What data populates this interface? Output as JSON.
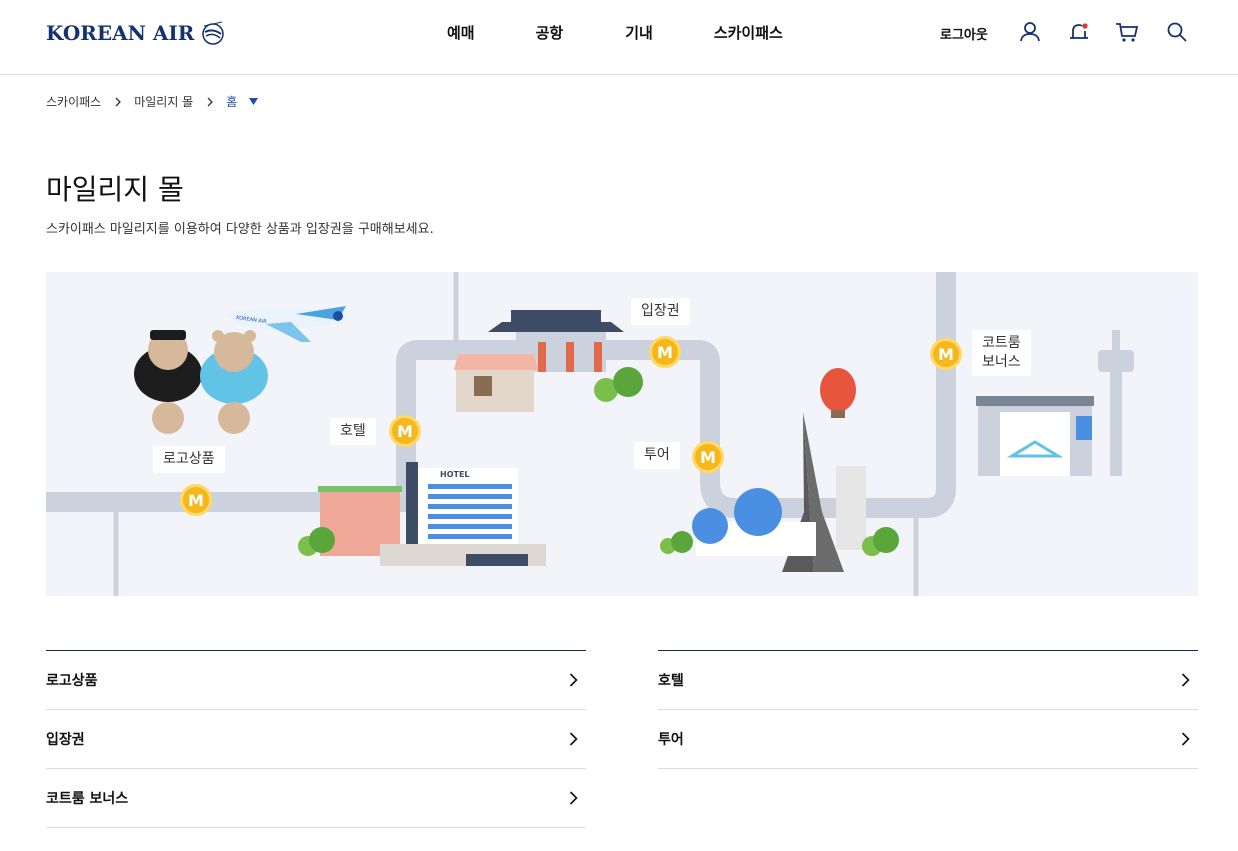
{
  "header": {
    "logo_text": "KOREAN AIR",
    "nav": [
      "예매",
      "공항",
      "기내",
      "스카이패스"
    ],
    "logout_label": "로그아웃",
    "icons": [
      "user-icon",
      "notification-bell-icon",
      "cart-icon",
      "search-icon"
    ],
    "notification_dot_color": "#e0352c"
  },
  "breadcrumb": {
    "items": [
      "스카이패스",
      "마일리지 몰"
    ],
    "current": "홈"
  },
  "page": {
    "title": "마일리지 몰",
    "description": "스카이패스 마일리지를 이용하여 다양한 상품과 입장권을 구매해보세요."
  },
  "map": {
    "labels": {
      "logo_goods": "로고상품",
      "hotel": "호텔",
      "ticket": "입장권",
      "tour": "투어",
      "cotroom_line1": "코트룸",
      "cotroom_line2": "보너스"
    },
    "badge_letter": "M",
    "hotel_sign": "HOTEL",
    "plane_text": "KOREAN AIR"
  },
  "lists": {
    "left": [
      "로고상품",
      "입장권",
      "코트룸 보너스"
    ],
    "right": [
      "호텔",
      "투어"
    ]
  },
  "colors": {
    "brand": "#16316f",
    "accent_link": "#1f4ea0",
    "badge": "#f4b81c",
    "map_bg": "#f3f4f9"
  }
}
